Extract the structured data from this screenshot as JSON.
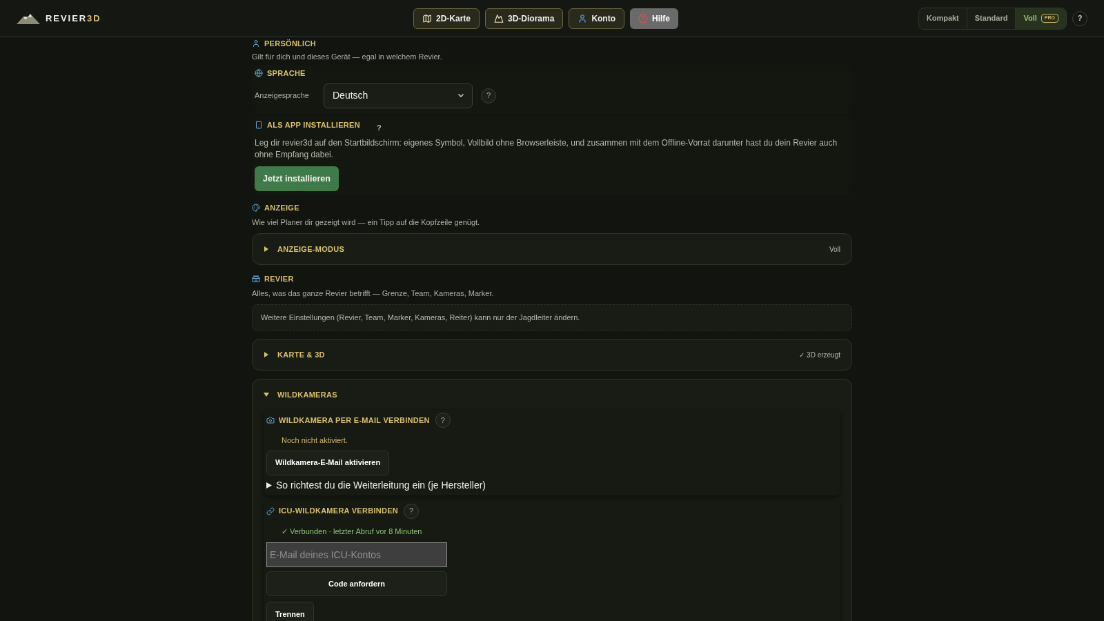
{
  "brand": {
    "name": "REVIER",
    "accent": "3D"
  },
  "nav": [
    {
      "label": "2D-Karte",
      "selected": false
    },
    {
      "label": "3D-Diorama",
      "selected": false
    },
    {
      "label": "Konto",
      "selected": false
    },
    {
      "label": "Hilfe",
      "selected": true
    }
  ],
  "modes": [
    {
      "label": "Kompakt",
      "selected": false
    },
    {
      "label": "Standard",
      "selected": false
    },
    {
      "label": "Voll",
      "selected": true,
      "badge": "PRO"
    }
  ],
  "help_button": "?",
  "personal": {
    "title": "PERSÖNLICH",
    "subtitle": "Gilt für dich und dieses Gerät — egal in welchem Revier.",
    "language": {
      "title": "SPRACHE",
      "label": "Anzeigesprache",
      "value": "Deutsch",
      "help": "?"
    },
    "install": {
      "title": "ALS APP INSTALLIEREN",
      "help": "?",
      "text": "Leg dir revier3d auf den Startbildschirm: eigenes Symbol, Vollbild ohne Browserleiste, und zusammen mit dem Offline-Vorrat darunter hast du dein Revier auch ohne Empfang dabei.",
      "button": "Jetzt installieren"
    }
  },
  "display": {
    "title": "ANZEIGE",
    "subtitle": "Wie viel Planer dir gezeigt wird — ein Tipp auf die Kopfzeile genügt.",
    "panels": [
      {
        "title": "ANZEIGE-MODUS",
        "expanded": false,
        "value": "Voll"
      }
    ]
  },
  "revier": {
    "title": "REVIER",
    "subtitle": "Alles, was das ganze Revier betrifft — Grenze, Team, Kameras, Marker.",
    "notice": "Weitere Einstellungen (Revier, Team, Marker, Kameras, Reiter) kann nur der Jagdleiter ändern.",
    "panels": [
      {
        "title": "KARTE & 3D",
        "expanded": false,
        "value": "✓ 3D erzeugt"
      },
      {
        "title": "WILDKAMERAS",
        "expanded": true,
        "cards": [
          {
            "kind": "email",
            "title": "WILDKAMERA PER E-MAIL VERBINDEN",
            "help": "?",
            "status": "Noch nicht aktiviert.",
            "buttons": [
              "Wildkamera-E-Mail aktivieren"
            ],
            "details": "So richtest du die Weiterleitung ein (je Hersteller)"
          },
          {
            "kind": "icu",
            "title": "ICU-WILDKAMERA VERBINDEN",
            "help": "?",
            "status": "✓ Verbunden · letzter Abruf vor 8 Minuten",
            "input": {
              "placeholder": "E-Mail deines ICU-Kontos"
            },
            "buttons": [
              "Code anfordern",
              "Trennen"
            ]
          }
        ]
      }
    ]
  }
}
